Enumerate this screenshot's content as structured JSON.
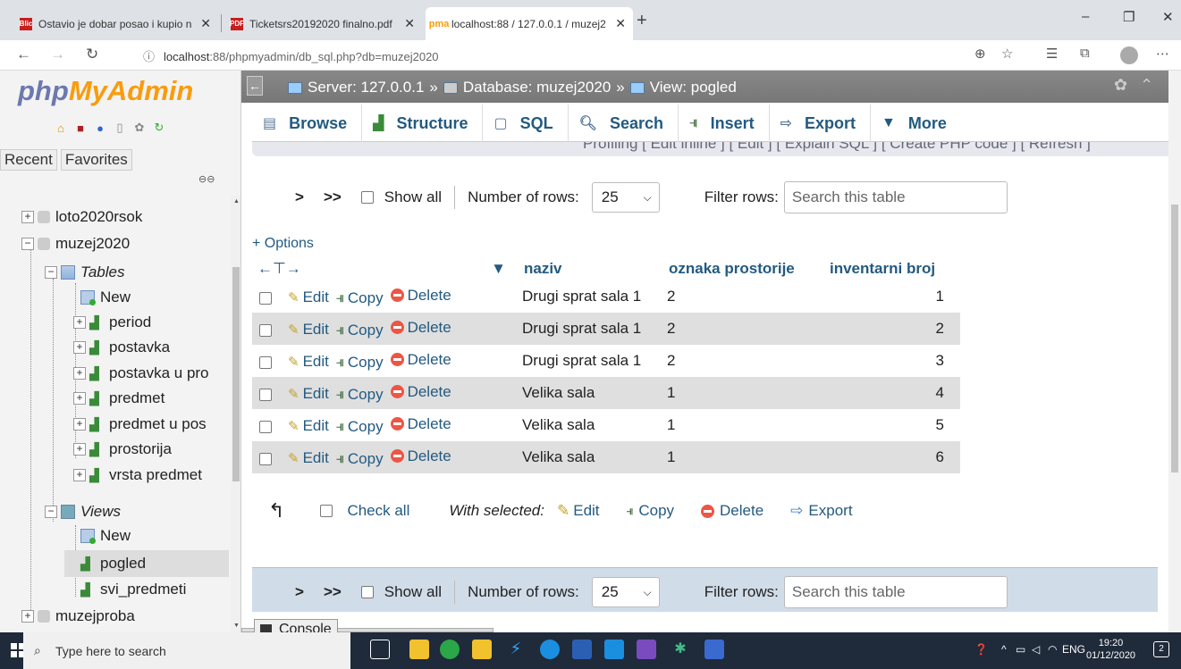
{
  "browser": {
    "tabs": [
      {
        "label": "Ostavio je dobar posao i kupio n",
        "favicon": "Blic",
        "favicon_color": "#c81e1e"
      },
      {
        "label": "Ticketsrs20192020 finalno.pdf",
        "favicon": "PDF",
        "favicon_color": "#c81e1e"
      },
      {
        "label": "localhost:88 / 127.0.0.1 / muzej2",
        "favicon": "pma",
        "favicon_color": "#f89c0e"
      }
    ],
    "url_host": "localhost",
    "url_rest": ":88/phpmyadmin/db_sql.php?db=muzej2020",
    "window_controls": [
      "–",
      "❐",
      "✕"
    ]
  },
  "sidebar": {
    "logo_php": "php",
    "logo_myadmin": "MyAdmin",
    "tabs": [
      "Recent",
      "Favorites"
    ],
    "tree": [
      {
        "label": "loto2020rsok"
      },
      {
        "label": "muzej2020"
      },
      {
        "label": "Tables"
      },
      {
        "label": "New"
      },
      {
        "label": "period"
      },
      {
        "label": "postavka"
      },
      {
        "label": "postavka u pro"
      },
      {
        "label": "predmet"
      },
      {
        "label": "predmet u pos"
      },
      {
        "label": "prostorija"
      },
      {
        "label": "vrsta predmet"
      },
      {
        "label": "Views"
      },
      {
        "label": "New"
      },
      {
        "label": "pogled"
      },
      {
        "label": "svi_predmeti"
      },
      {
        "label": "muzejproba"
      }
    ]
  },
  "breadcrumb": {
    "server": "Server: 127.0.0.1",
    "sep1": "»",
    "database": "Database: muzej2020",
    "sep2": "»",
    "view": "View: pogled"
  },
  "menu": [
    "Browse",
    "Structure",
    "SQL",
    "Search",
    "Insert",
    "Export",
    "More"
  ],
  "menu_overflow_text": "Profiling [ Edit inline ] [ Edit ] [ Explain SQL ] [ Create PHP code ] [ Refresh ]",
  "nav": {
    "gt": ">",
    "gtgt": ">>",
    "show_all": "Show all",
    "rows_label": "Number of rows:",
    "rows_value": "25",
    "filter_label": "Filter rows:",
    "filter_placeholder": "Search this table"
  },
  "options_link": "+ Options",
  "table": {
    "columns": [
      "naziv",
      "oznaka prostorije",
      "inventarni broj"
    ],
    "action_labels": {
      "edit": "Edit",
      "copy": "Copy",
      "delete": "Delete"
    },
    "rows": [
      {
        "naziv": "Drugi sprat sala 1",
        "oznaka": "2",
        "broj": "1"
      },
      {
        "naziv": "Drugi sprat sala 1",
        "oznaka": "2",
        "broj": "2"
      },
      {
        "naziv": "Drugi sprat sala 1",
        "oznaka": "2",
        "broj": "3"
      },
      {
        "naziv": "Velika sala",
        "oznaka": "1",
        "broj": "4"
      },
      {
        "naziv": "Velika sala",
        "oznaka": "1",
        "broj": "5"
      },
      {
        "naziv": "Velika sala",
        "oznaka": "1",
        "broj": "6"
      }
    ]
  },
  "bulk": {
    "check_all": "Check all",
    "with_selected": "With selected:",
    "edit": "Edit",
    "copy": "Copy",
    "delete": "Delete",
    "export": "Export"
  },
  "console_label": "Console",
  "taskbar": {
    "search_placeholder": "Type here to search",
    "lang": "ENG",
    "time": "19:20",
    "date": "01/12/2020",
    "notifications": "2"
  }
}
